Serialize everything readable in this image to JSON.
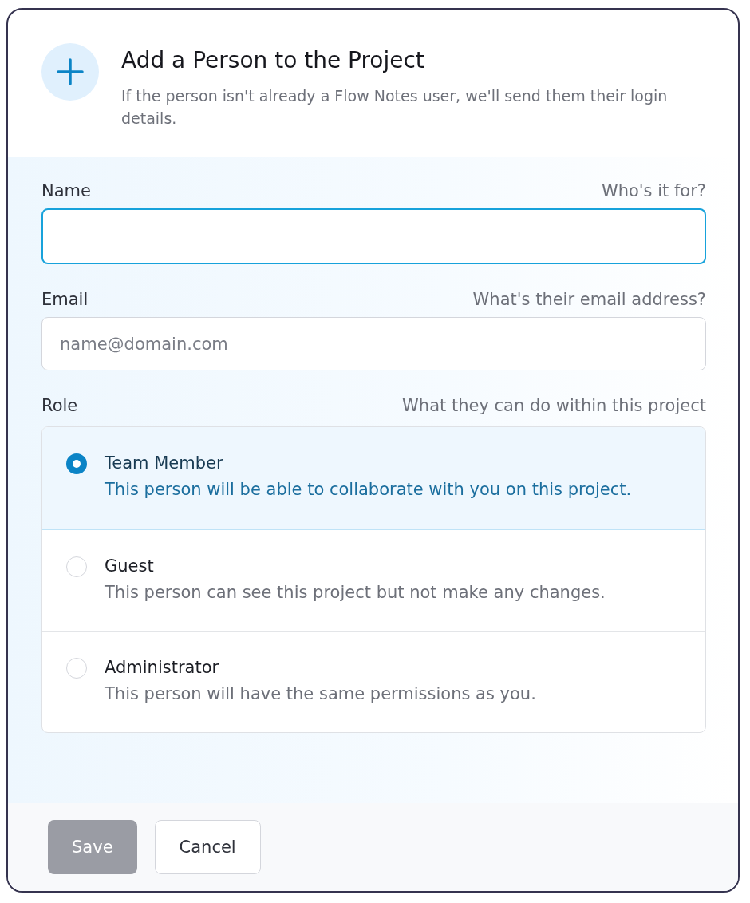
{
  "dialog": {
    "title": "Add a Person to the Project",
    "subtitle": "If the person isn't already a Flow Notes user, we'll send them their login details."
  },
  "fields": [
    {
      "label": "Name",
      "hint": "Who's it for?",
      "focused": true
    },
    {
      "label": "Email",
      "hint": "What's their email address?",
      "placeholder": "name@domain.com",
      "focused": false
    }
  ],
  "role": {
    "label": "Role",
    "hint": "What they can do within this project",
    "options": [
      {
        "title": "Team Member",
        "description": "This person will be able to collaborate with you on this project.",
        "selected": true
      },
      {
        "title": "Guest",
        "description": "This person can see this project but not make any changes.",
        "selected": false
      },
      {
        "title": "Administrator",
        "description": "This person will have the same permissions as you.",
        "selected": false
      }
    ]
  },
  "buttons": [
    {
      "label": "Save",
      "kind": "primary",
      "disabled": true
    },
    {
      "label": "Cancel",
      "kind": "secondary",
      "disabled": false
    }
  ]
}
